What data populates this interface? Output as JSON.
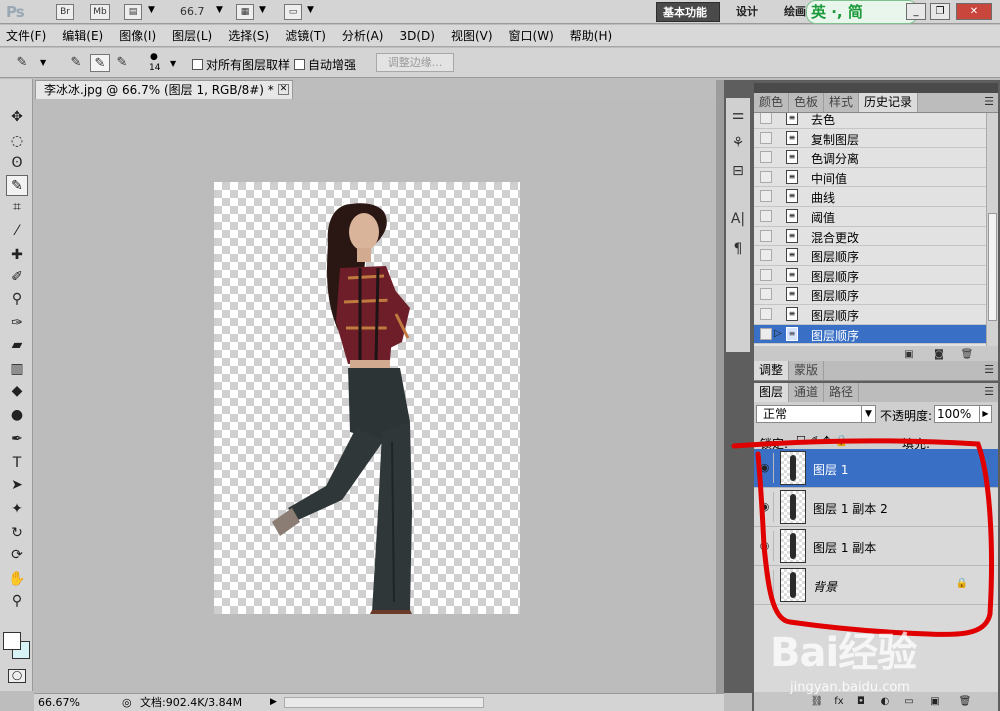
{
  "appbar": {
    "logo": "Ps",
    "bridge": "Br",
    "minibridge": "Mb",
    "zoom": "66.7",
    "workspaces": {
      "basic": "基本功能",
      "design": "设计",
      "paint": "绘画"
    },
    "ime": "英 ·, 简"
  },
  "menu": [
    "文件(F)",
    "编辑(E)",
    "图像(I)",
    "图层(L)",
    "选择(S)",
    "滤镜(T)",
    "分析(A)",
    "3D(D)",
    "视图(V)",
    "窗口(W)",
    "帮助(H)"
  ],
  "options": {
    "brush_size": "14",
    "sample_all": "对所有图层取样",
    "auto_enhance": "自动增强",
    "refine_edge": "调整边缘..."
  },
  "document": {
    "tab_title": "李冰冰.jpg @ 66.7% (图层 1, RGB/8#) *",
    "status_zoom": "66.67%",
    "status_doc": "文档:902.4K/3.84M"
  },
  "history_panel": {
    "tabs": [
      "颜色",
      "色板",
      "样式",
      "历史记录"
    ],
    "items": [
      "去色",
      "复制图层",
      "色调分离",
      "中间值",
      "曲线",
      "阈值",
      "混合更改",
      "图层顺序",
      "图层顺序",
      "图层顺序",
      "图层顺序",
      "图层顺序"
    ],
    "selected_index": 11
  },
  "adjust_tabs": [
    "调整",
    "蒙版"
  ],
  "layers_panel": {
    "tabs": [
      "图层",
      "通道",
      "路径"
    ],
    "blend_mode": "正常",
    "opacity_label": "不透明度:",
    "opacity": "100%",
    "lock_label": "锁定:",
    "fill_label": "填充:",
    "layers": [
      {
        "name": "图层 1",
        "visible": true,
        "selected": true
      },
      {
        "name": "图层 1 副本 2",
        "visible": true,
        "selected": false
      },
      {
        "name": "图层 1 副本",
        "visible": true,
        "selected": false
      },
      {
        "name": "背景",
        "visible": false,
        "selected": false,
        "locked": true
      }
    ]
  },
  "watermark": {
    "brand": "Bai经验",
    "url": "jingyan.baidu.com"
  },
  "colors": {
    "selection": "#3a6fc6",
    "annotation": "#e00000",
    "ws_active": "#4a4a4a",
    "bg_swatch": "#d8f3f6"
  }
}
